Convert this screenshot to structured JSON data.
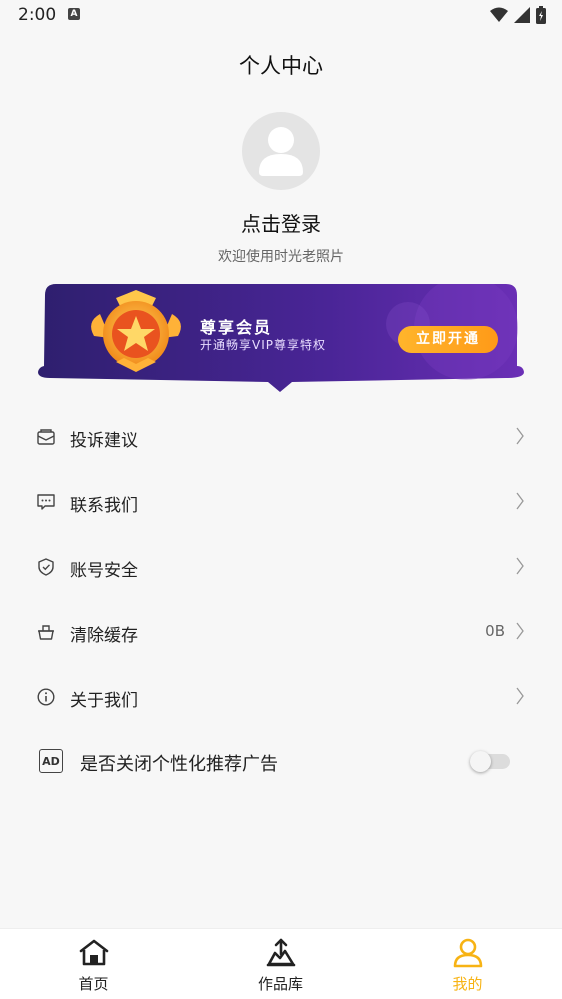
{
  "status_bar": {
    "time": "2:00",
    "notification_icon": "A"
  },
  "page": {
    "title": "个人中心"
  },
  "profile": {
    "login_text": "点击登录",
    "welcome_text": "欢迎使用时光老照片"
  },
  "vip": {
    "title": "尊享会员",
    "subtitle": "开通畅享VIP尊享特权",
    "button_label": "立即开通",
    "colors": {
      "banner_from": "#2e1f6e",
      "banner_to": "#6b2fb6",
      "button": "#ffa51f",
      "medal": "#f4b02a"
    }
  },
  "menu": {
    "items": [
      {
        "label": "投诉建议",
        "icon": "mail-icon"
      },
      {
        "label": "联系我们",
        "icon": "chat-icon"
      },
      {
        "label": "账号安全",
        "icon": "shield-icon"
      },
      {
        "label": "清除缓存",
        "icon": "basket-icon",
        "value": "0B"
      },
      {
        "label": "关于我们",
        "icon": "info-icon"
      }
    ],
    "ad_toggle": {
      "icon_text": "AD",
      "label": "是否关闭个性化推荐广告",
      "enabled": false
    }
  },
  "bottom_nav": {
    "items": [
      {
        "label": "首页",
        "icon": "home-icon",
        "active": false
      },
      {
        "label": "作品库",
        "icon": "gallery-upload-icon",
        "active": false
      },
      {
        "label": "我的",
        "icon": "user-icon",
        "active": true
      }
    ],
    "active_color": "#f7b314"
  }
}
